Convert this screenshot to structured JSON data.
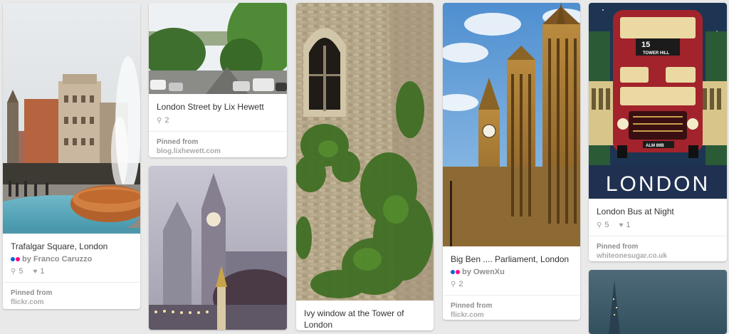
{
  "colors": {
    "background": "#e9e9e9",
    "flickr_pink": "#ff0084",
    "flickr_blue": "#0063dc"
  },
  "pins": [
    {
      "description": "Trafalgar Square, London",
      "via_prefix": "by",
      "via_name": "Franco Caruzzo",
      "via_icon": "flickr-icon",
      "repins": "5",
      "likes": "1",
      "pinned_label": "Pinned from",
      "source": "flickr.com"
    },
    {
      "description": "London Street by Lix Hewett",
      "repins": "2",
      "pinned_label": "Pinned from",
      "source": "blog.lixhewett.com"
    },
    {
      "description": "Ivy window at the Tower of London"
    },
    {
      "description": "Big Ben .... Parliament, London",
      "via_prefix": "by",
      "via_name": "OwenXu",
      "via_icon": "flickr-icon",
      "repins": "2",
      "pinned_label": "Pinned from",
      "source": "flickr.com"
    },
    {
      "description": "London Bus at Night",
      "repins": "5",
      "likes": "1",
      "pinned_label": "Pinned from",
      "source": "whiteonesugar.co.uk"
    }
  ],
  "bus_art": {
    "route_number": "15",
    "destination": "TOWER HILL",
    "plate": "ALM 89B",
    "poster_word": "LONDON"
  },
  "icons": {
    "repin": "repin-icon",
    "like": "heart-icon"
  }
}
